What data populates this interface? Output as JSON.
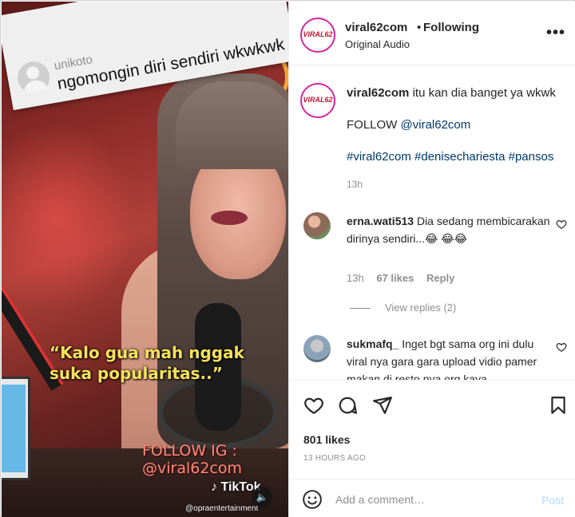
{
  "video": {
    "overlay_comment": {
      "username": "unikoto",
      "text": "ngomongin diri sendiri wkwkwk"
    },
    "quote": "“Kalo gua mah nggak suka popularitas..”",
    "follow_line1": "FOLLOW IG :",
    "follow_line2": "@viral62com",
    "tiktok_label": "TikTok",
    "tiktok_credit": "@opraentertainment",
    "mute_icon": "speaker-icon"
  },
  "header": {
    "username": "viral62com",
    "separator": "•",
    "follow_status": "Following",
    "audio": "Original Audio",
    "avatar_brand": "VIRAL62",
    "more_icon": "more-horizontal-icon"
  },
  "caption": {
    "username": "viral62com",
    "text": "itu kan dia banget ya wkwk",
    "follow_prefix": "FOLLOW ",
    "follow_mention": "@viral62com",
    "hashtags": "#viral62com #denisechariesta #pansos",
    "time": "13h"
  },
  "comments": [
    {
      "username": "erna.wati513",
      "text": "Dia sedang membicarakan dirinya sendiri...😂 😂😂",
      "time": "13h",
      "likes": "67 likes",
      "reply": "Reply",
      "view_replies": "View replies (2)"
    },
    {
      "username": "sukmafq_",
      "text": "Inget bgt sama org ini dulu viral nya gara gara upload vidio pamer makan di resto nya org kaya"
    }
  ],
  "actions": {
    "likes": "801 likes",
    "time_ago": "13 HOURS AGO"
  },
  "add_comment": {
    "placeholder": "Add a comment…",
    "post_label": "Post"
  },
  "colors": {
    "link": "#00376b",
    "muted": "#8e8e8e",
    "post_disabled": "#b3dbff",
    "avatar_ring": "#d6249f"
  }
}
